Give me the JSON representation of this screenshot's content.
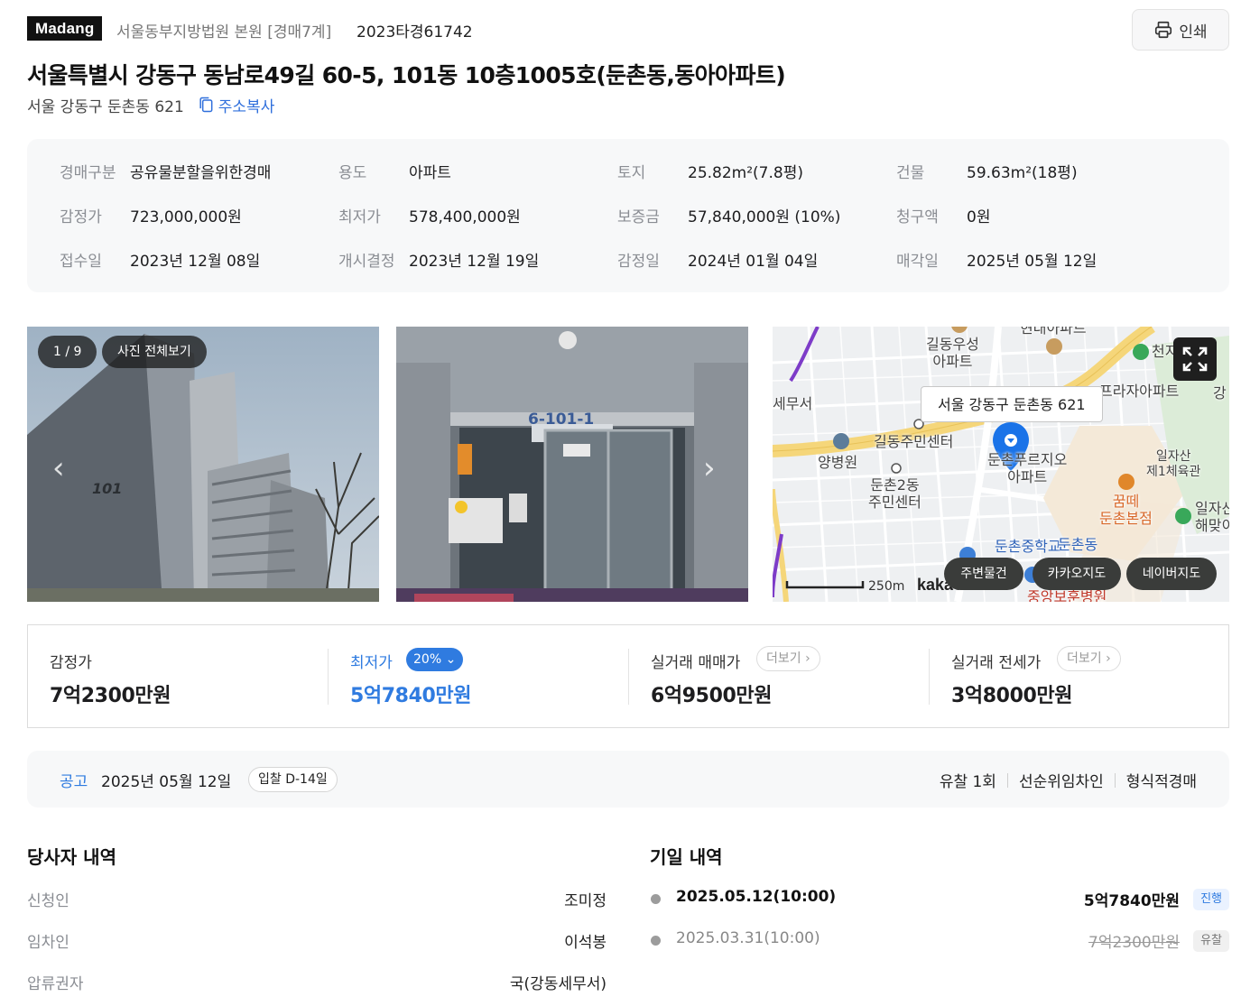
{
  "header": {
    "logo": "Madang",
    "court": "서울동부지방법원 본원 [경매7계]",
    "case_number": "2023타경61742",
    "print_label": "인쇄"
  },
  "property": {
    "title": "서울특별시 강동구 동남로49길 60-5, 101동 10층1005호(둔촌동,동아아파트)",
    "jibun_address": "서울 강동구 둔촌동 621",
    "copy_address_label": "주소복사"
  },
  "info": [
    {
      "label": "경매구분",
      "value": "공유물분할을위한경매"
    },
    {
      "label": "용도",
      "value": "아파트"
    },
    {
      "label": "토지",
      "value": "25.82m²(7.8평)"
    },
    {
      "label": "건물",
      "value": "59.63m²(18평)"
    },
    {
      "label": "감정가",
      "value": "723,000,000원"
    },
    {
      "label": "최저가",
      "value": "578,400,000원"
    },
    {
      "label": "보증금",
      "value": "57,840,000원 (10%)"
    },
    {
      "label": "청구액",
      "value": "0원"
    },
    {
      "label": "접수일",
      "value": "2023년 12월 08일"
    },
    {
      "label": "개시결정",
      "value": "2023년 12월 19일"
    },
    {
      "label": "감정일",
      "value": "2024년 01월 04일"
    },
    {
      "label": "매각일",
      "value": "2025년 05월 12일"
    }
  ],
  "gallery": {
    "counter": "1 / 9",
    "view_all": "사진 전체보기",
    "building_number_text": "101",
    "entrance_sign_text": "6-101-1"
  },
  "map": {
    "callout": "서울 강동구 둔촌동 621",
    "places": {
      "gildong_post": "길동우성\n아파트",
      "top_apt": "현대아파트",
      "plaza_apt": "프라자아파트",
      "cheonji": "천지",
      "tax_office": "세무서",
      "center": "길동주민센터",
      "yangbyeongwon": "양병원",
      "dunchon2": "둔촌2동\n주민센터",
      "prugio": "둔촌푸르지오\n아파트",
      "ilja_gym": "일자산\n제1체육관",
      "ggumtte": "꿈떼\n둔촌본점",
      "ilja_right": "일자산\n해맞이",
      "middle_school": "둔촌중학교",
      "hospital": "중앙보훈병원",
      "dong": "둔촌동",
      "gang": "강"
    },
    "scale_label": "250m",
    "brand": "kakao",
    "buttons": [
      "주변물건",
      "카카오지도",
      "네이버지도"
    ]
  },
  "prices": {
    "appraisal": {
      "label": "감정가",
      "value": "7억2300만원"
    },
    "minimum": {
      "label": "최저가",
      "value": "5억7840만원",
      "discount_badge": "20%"
    },
    "actual_sale": {
      "label": "실거래 매매가",
      "more": "더보기",
      "value": "6억9500만원"
    },
    "actual_jeonse": {
      "label": "실거래 전세가",
      "more": "더보기",
      "value": "3억8000만원"
    }
  },
  "notice": {
    "label": "공고",
    "date": "2025년 05월 12일",
    "dday": "입찰 D-14일",
    "tags": [
      "유찰 1회",
      "선순위임차인",
      "형식적경매"
    ]
  },
  "parties": {
    "title": "당사자 내역",
    "rows": [
      {
        "role": "신청인",
        "name": "조미정"
      },
      {
        "role": "임차인",
        "name": "이석봉"
      },
      {
        "role": "압류권자",
        "name": "국(강동세무서)"
      }
    ]
  },
  "schedule": {
    "title": "기일 내역",
    "rows": [
      {
        "date": "2025.05.12(10:00)",
        "amount": "5억7840만원",
        "status": "진행"
      },
      {
        "date": "2025.03.31(10:00)",
        "amount": "7억2300만원",
        "status": "유찰"
      }
    ]
  },
  "colors": {
    "accent_blue": "#2f7be0",
    "logo_bg": "#111111",
    "map_pin": "#1a73e8",
    "panel_bg": "#f7f8f9"
  }
}
